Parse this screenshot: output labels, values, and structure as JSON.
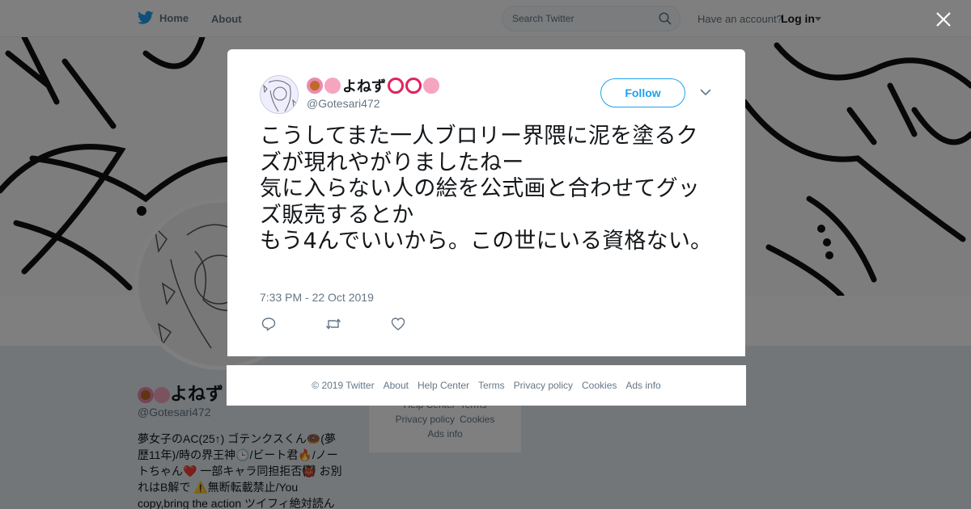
{
  "nav": {
    "home_label": "Home",
    "about_label": "About",
    "search_placeholder": "Search Twitter",
    "account_prompt": "Have an account?",
    "login_label": "Log in"
  },
  "profile": {
    "name_text": "よねず",
    "handle": "@Gotesari472",
    "bio_lines": [
      "夢女子のAC(25↑) ゴテンクスくん🍩(夢",
      "歴11年)/時の界王神🕒/ビート君🔥/ノー",
      "トちゃん❤️ 一部キャラ同担拒否👹 お別",
      "れはB解で ⚠️無断転載禁止/You",
      "copy,bring the action ツイフィ絶対読ん"
    ],
    "side_links": {
      "row1": [
        "Help Center",
        "Terms"
      ],
      "row2": [
        "Privacy policy",
        "Cookies"
      ],
      "row3": [
        "Ads info"
      ]
    }
  },
  "tweet": {
    "display_name": "よねず",
    "handle": "@Gotesari472",
    "follow_label": "Follow",
    "text": "こうしてまた一人ブロリー界隈に泥を塗るクズが現れやがりましたねー\n気に入らない人の絵を公式画と合わせてグッズ販売するとか\nもう4んでいいから。この世にいる資格ない。",
    "timestamp": "7:33 PM - 22 Oct 2019"
  },
  "footer": {
    "copyright": "© 2019 Twitter",
    "links": [
      "About",
      "Help Center",
      "Terms",
      "Privacy policy",
      "Cookies",
      "Ads info"
    ]
  },
  "colors": {
    "twitter_blue": "#1da1f2",
    "muted": "#657786",
    "overlay": "rgba(0,0,0,0.5)"
  },
  "icons": [
    "twitter-bird-icon",
    "search-icon",
    "close-icon",
    "chevron-down-icon",
    "reply-icon",
    "retweet-icon",
    "like-icon",
    "donut-emoji-icon",
    "flower-emoji-icon",
    "clock-emoji-icon"
  ]
}
